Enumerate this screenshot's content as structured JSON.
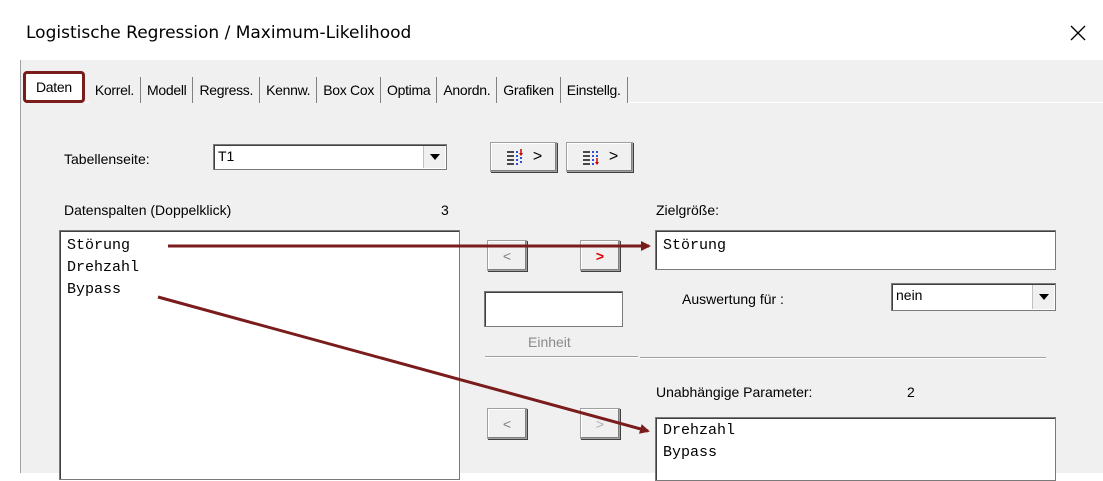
{
  "window": {
    "title": "Logistische Regression / Maximum-Likelihood",
    "close_glyph": "✕"
  },
  "tabs": [
    {
      "label": "Daten",
      "active": true
    },
    {
      "label": "Korrel."
    },
    {
      "label": "Modell"
    },
    {
      "label": "Regress."
    },
    {
      "label": "Kennw."
    },
    {
      "label": "Box Cox"
    },
    {
      "label": "Optima"
    },
    {
      "label": "Anordn."
    },
    {
      "label": "Grafiken"
    },
    {
      "label": "Einstellg."
    }
  ],
  "table_page": {
    "label": "Tabellenseite:",
    "value": "T1"
  },
  "data_columns": {
    "label": "Datenspalten (Doppelklick)",
    "count": "3",
    "items": [
      "Störung",
      "Drehzahl",
      "Bypass"
    ]
  },
  "buttons": {
    "move_left_target": "<",
    "move_right_target": ">",
    "move_left_params": "<",
    "move_right_params": ">",
    "sort_asc_glyph": ">",
    "sort_desc_glyph": ">"
  },
  "unit": {
    "label": "Einheit",
    "value": ""
  },
  "target": {
    "label": "Zielgröße:",
    "value": "Störung",
    "evaluation_label": "Auswertung für :",
    "evaluation_value": "nein"
  },
  "independent": {
    "label": "Unabhängige Parameter:",
    "count": "2",
    "items": [
      "Drehzahl",
      "Bypass"
    ]
  },
  "colors": {
    "annotation": "#7b1c1c",
    "red_arrow": "#e00000",
    "panel": "#f0f0f0"
  },
  "icons": {
    "close": "close-icon",
    "sort_asc": "sort-columns-icon",
    "sort_desc": "sort-columns-down-icon",
    "dropdown": "chevron-down-icon"
  }
}
